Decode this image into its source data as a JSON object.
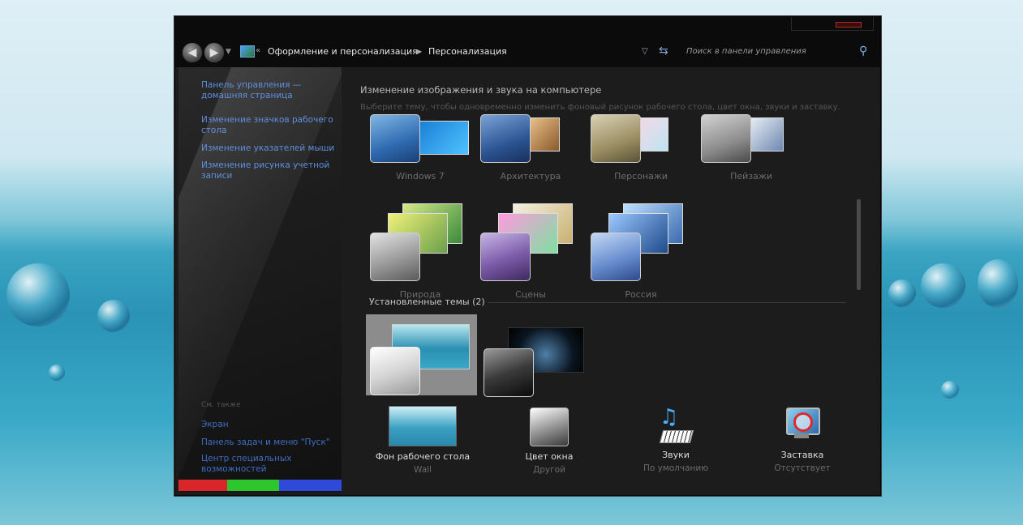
{
  "colors": {
    "accent_link": "#5f8fe0",
    "window_bg": "#1b1b1b"
  },
  "address": {
    "crumb1": "Оформление и персонализация",
    "crumb2": "Персонализация",
    "search_placeholder": "Поиск в панели управления",
    "chevrons": "«",
    "crumb_arrow": "▶"
  },
  "sidebar": {
    "links": [
      "Панель управления — домашняя страница",
      "Изменение значков рабочего стола",
      "Изменение указателей мыши",
      "Изменение рисунка учетной записи"
    ],
    "see_also": "См. также",
    "bottom_links": [
      "Экран",
      "Панель задач и меню \"Пуск\"",
      "Центр специальных возможностей"
    ]
  },
  "main": {
    "header": "Изменение изображения и звука на компьютере",
    "subheader": "Выберите тему, чтобы одновременно изменить фоновый рисунок рабочего стола, цвет окна, звуки и заставку.",
    "themes_row1": [
      "Windows 7",
      "Архитектура",
      "Персонажи",
      "Пейзажи"
    ],
    "themes_row2": [
      "Природа",
      "Сцены",
      "Россия"
    ],
    "installed_label": "Установленные темы (2)"
  },
  "bottom": [
    {
      "title": "Фон рабочего стола",
      "value": "Wall",
      "icon": "wallpaper-icon"
    },
    {
      "title": "Цвет окна",
      "value": "Другой",
      "icon": "window-color-icon"
    },
    {
      "title": "Звуки",
      "value": "По умолчанию",
      "icon": "sounds-icon"
    },
    {
      "title": "Заставка",
      "value": "Отсутствует",
      "icon": "screensaver-icon"
    }
  ]
}
